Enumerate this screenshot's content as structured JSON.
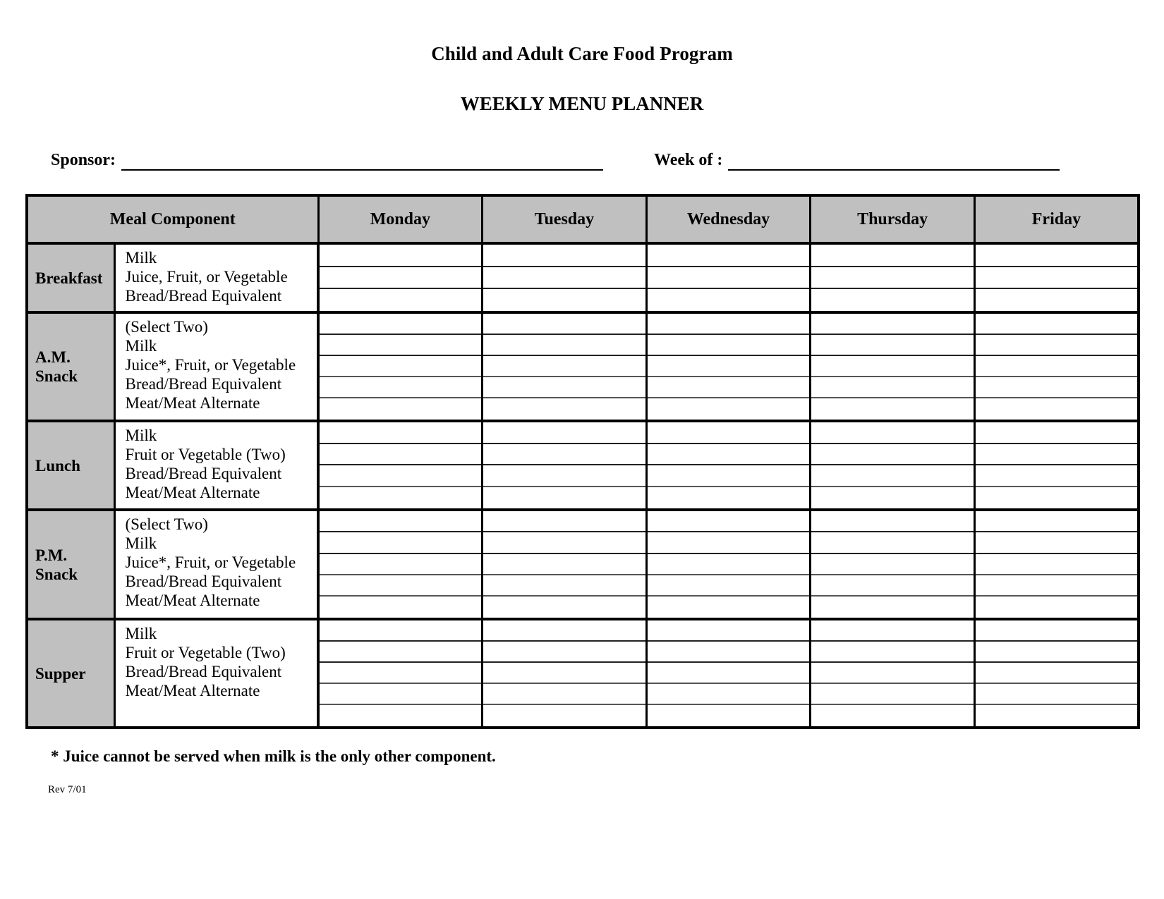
{
  "document": {
    "title": "Child and Adult Care Food Program",
    "subtitle": "WEEKLY MENU PLANNER",
    "revision": "Rev 7/01",
    "footnote": "* Juice cannot be served when milk is the only other component."
  },
  "form": {
    "sponsor_label": "Sponsor:",
    "sponsor_value": "",
    "week_of_label": "Week of :",
    "week_of_value": ""
  },
  "table": {
    "headers": {
      "meal_component": "Meal Component",
      "days": [
        "Monday",
        "Tuesday",
        "Wednesday",
        "Thursday",
        "Friday"
      ]
    },
    "sections": [
      {
        "meal": "Breakfast",
        "components": [
          "Milk",
          "Juice, Fruit, or Vegetable",
          "Bread/Bread Equivalent"
        ],
        "slot_count": 3
      },
      {
        "meal": "A.M.\nSnack",
        "meal_line1": "A.M.",
        "meal_line2": "Snack",
        "components": [
          "(Select Two)",
          "Milk",
          "Juice*, Fruit, or Vegetable",
          "Bread/Bread Equivalent",
          "Meat/Meat Alternate"
        ],
        "slot_count": 5
      },
      {
        "meal": "Lunch",
        "components": [
          "Milk",
          "Fruit or Vegetable (Two)",
          "Bread/Bread Equivalent",
          "Meat/Meat Alternate"
        ],
        "slot_count": 4
      },
      {
        "meal": "P.M.\nSnack",
        "meal_line1": "P.M.",
        "meal_line2": "Snack",
        "components": [
          "(Select Two)",
          "Milk",
          "Juice*, Fruit, or Vegetable",
          "Bread/Bread Equivalent",
          "Meat/Meat Alternate"
        ],
        "slot_count": 5
      },
      {
        "meal": "Supper",
        "components": [
          "Milk",
          "Fruit or Vegetable (Two)",
          "Bread/Bread Equivalent",
          "Meat/Meat Alternate"
        ],
        "slot_count": 5
      }
    ],
    "cell_values": {
      "Breakfast": {
        "Monday": [
          "",
          "",
          ""
        ],
        "Tuesday": [
          "",
          "",
          ""
        ],
        "Wednesday": [
          "",
          "",
          ""
        ],
        "Thursday": [
          "",
          "",
          ""
        ],
        "Friday": [
          "",
          "",
          ""
        ]
      },
      "A.M. Snack": {
        "Monday": [
          "",
          "",
          "",
          "",
          ""
        ],
        "Tuesday": [
          "",
          "",
          "",
          "",
          ""
        ],
        "Wednesday": [
          "",
          "",
          "",
          "",
          ""
        ],
        "Thursday": [
          "",
          "",
          "",
          "",
          ""
        ],
        "Friday": [
          "",
          "",
          "",
          "",
          ""
        ]
      },
      "Lunch": {
        "Monday": [
          "",
          "",
          "",
          ""
        ],
        "Tuesday": [
          "",
          "",
          "",
          ""
        ],
        "Wednesday": [
          "",
          "",
          "",
          ""
        ],
        "Thursday": [
          "",
          "",
          "",
          ""
        ],
        "Friday": [
          "",
          "",
          "",
          ""
        ]
      },
      "P.M. Snack": {
        "Monday": [
          "",
          "",
          "",
          "",
          ""
        ],
        "Tuesday": [
          "",
          "",
          "",
          "",
          ""
        ],
        "Wednesday": [
          "",
          "",
          "",
          "",
          ""
        ],
        "Thursday": [
          "",
          "",
          "",
          "",
          ""
        ],
        "Friday": [
          "",
          "",
          "",
          "",
          ""
        ]
      },
      "Supper": {
        "Monday": [
          "",
          "",
          "",
          "",
          ""
        ],
        "Tuesday": [
          "",
          "",
          "",
          "",
          ""
        ],
        "Wednesday": [
          "",
          "",
          "",
          "",
          ""
        ],
        "Thursday": [
          "",
          "",
          "",
          "",
          ""
        ],
        "Friday": [
          "",
          "",
          "",
          "",
          ""
        ]
      }
    }
  },
  "colors": {
    "header_fill": "#c0c0c0",
    "label_fill": "#c0c0c0",
    "border": "#000000",
    "page_background": "#ffffff",
    "text": "#000000"
  }
}
